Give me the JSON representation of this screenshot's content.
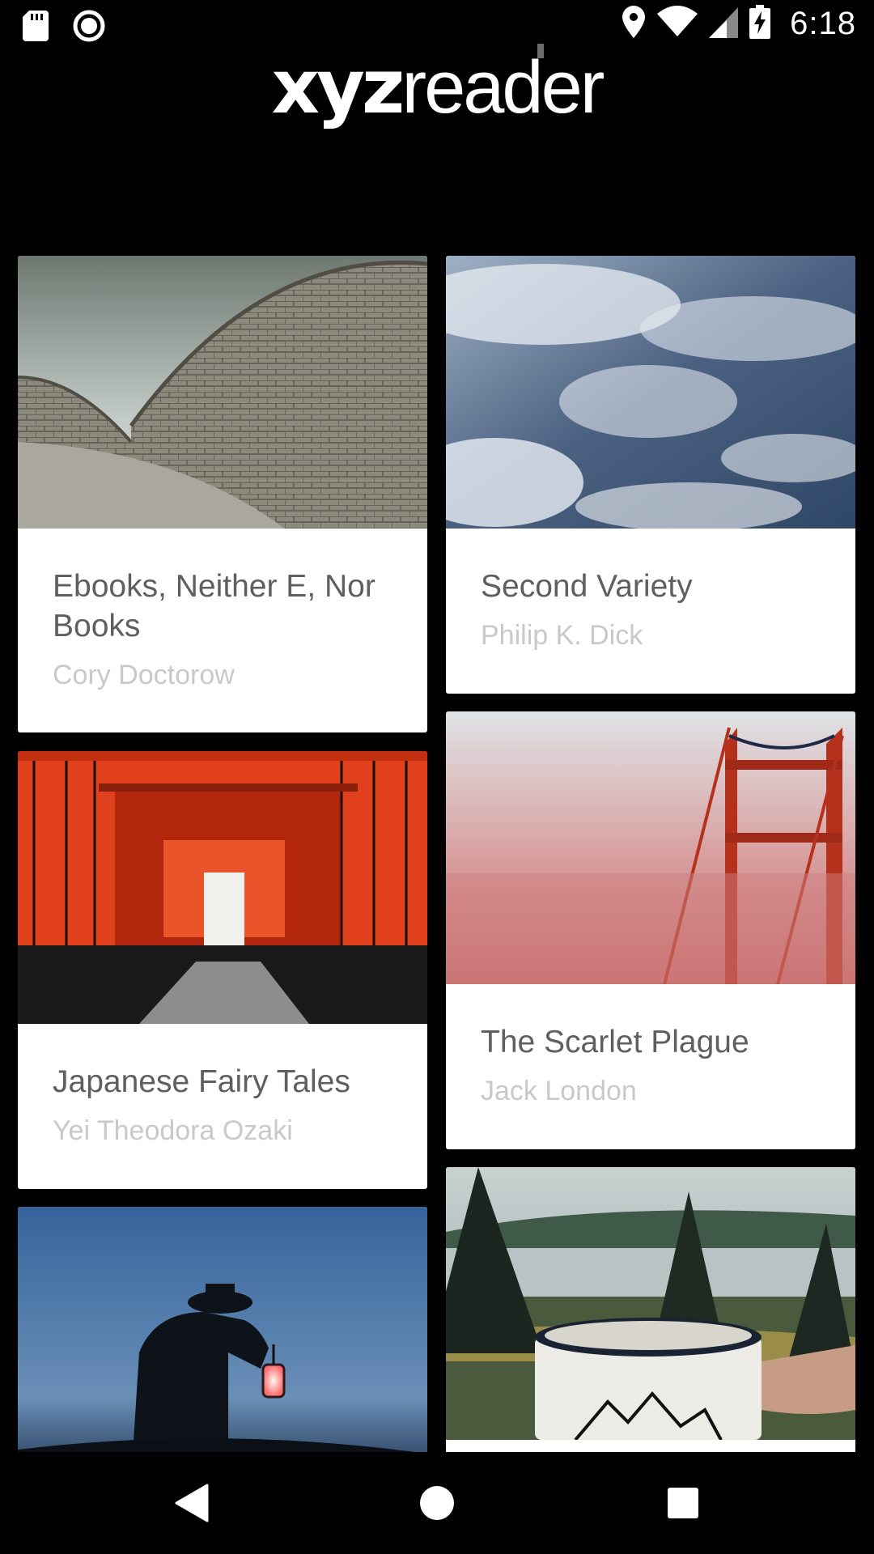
{
  "status_bar": {
    "time": "6:18",
    "icons": [
      "sd-card-icon",
      "recording-icon",
      "location-icon",
      "wifi-icon",
      "cell-signal-icon",
      "battery-charging-icon"
    ]
  },
  "app": {
    "logo_bold": "xyz",
    "logo_light": "reader"
  },
  "articles": [
    {
      "title": "Ebooks, Neither E, Nor Books",
      "author": "Cory Doctorow",
      "image": "opera-house-roof-image"
    },
    {
      "title": "Second Variety",
      "author": "Philip K. Dick",
      "image": "earth-clouds-image"
    },
    {
      "title": "Japanese Fairy Tales",
      "author": "Yei Theodora Ozaki",
      "image": "torii-gates-image"
    },
    {
      "title": "The Scarlet Plague",
      "author": "Jack London",
      "image": "golden-gate-fog-image"
    },
    {
      "title": "",
      "author": "",
      "image": "lantern-silhouette-image"
    },
    {
      "title": "",
      "author": "",
      "image": "camping-mug-lake-image"
    }
  ],
  "nav_bar": {
    "icons": [
      "back-icon",
      "home-icon",
      "recents-icon"
    ]
  },
  "colors": {
    "background": "#000000",
    "card": "#ffffff",
    "title_text": "#5f5f5f",
    "author_text": "#c9c9c9"
  }
}
